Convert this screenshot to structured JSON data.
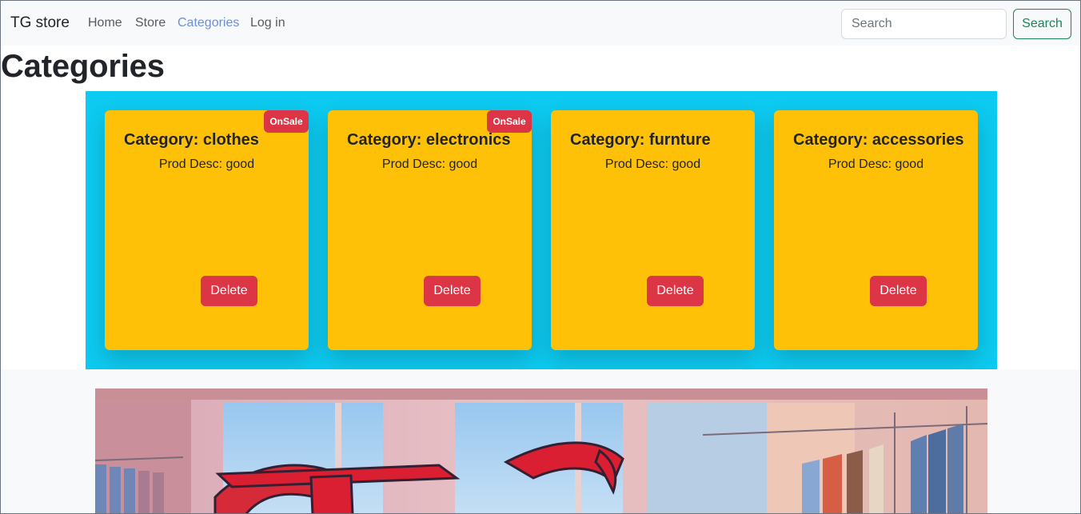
{
  "navbar": {
    "brand": "TG store",
    "links": [
      {
        "label": "Home",
        "active": false
      },
      {
        "label": "Store",
        "active": false
      },
      {
        "label": "Categories",
        "active": true
      },
      {
        "label": "Log in",
        "active": false
      }
    ],
    "search": {
      "placeholder": "Search",
      "button_label": "Search"
    }
  },
  "page": {
    "title": "Categories"
  },
  "categories": [
    {
      "title": "Category: clothes",
      "desc": "Prod Desc: good",
      "badge": "OnSale",
      "delete_label": "Delete"
    },
    {
      "title": "Category: electronics",
      "desc": "Prod Desc: good",
      "badge": "OnSale",
      "delete_label": "Delete"
    },
    {
      "title": "Category: furnture",
      "desc": "Prod Desc: good",
      "badge": "",
      "delete_label": "Delete"
    },
    {
      "title": "Category: accessories",
      "desc": "Prod Desc: good",
      "badge": "",
      "delete_label": "Delete"
    }
  ],
  "colors": {
    "panel": "#0dcaf0",
    "card": "#ffc107",
    "danger": "#dc3545",
    "success": "#198754",
    "active_link": "#6d8fd6"
  }
}
